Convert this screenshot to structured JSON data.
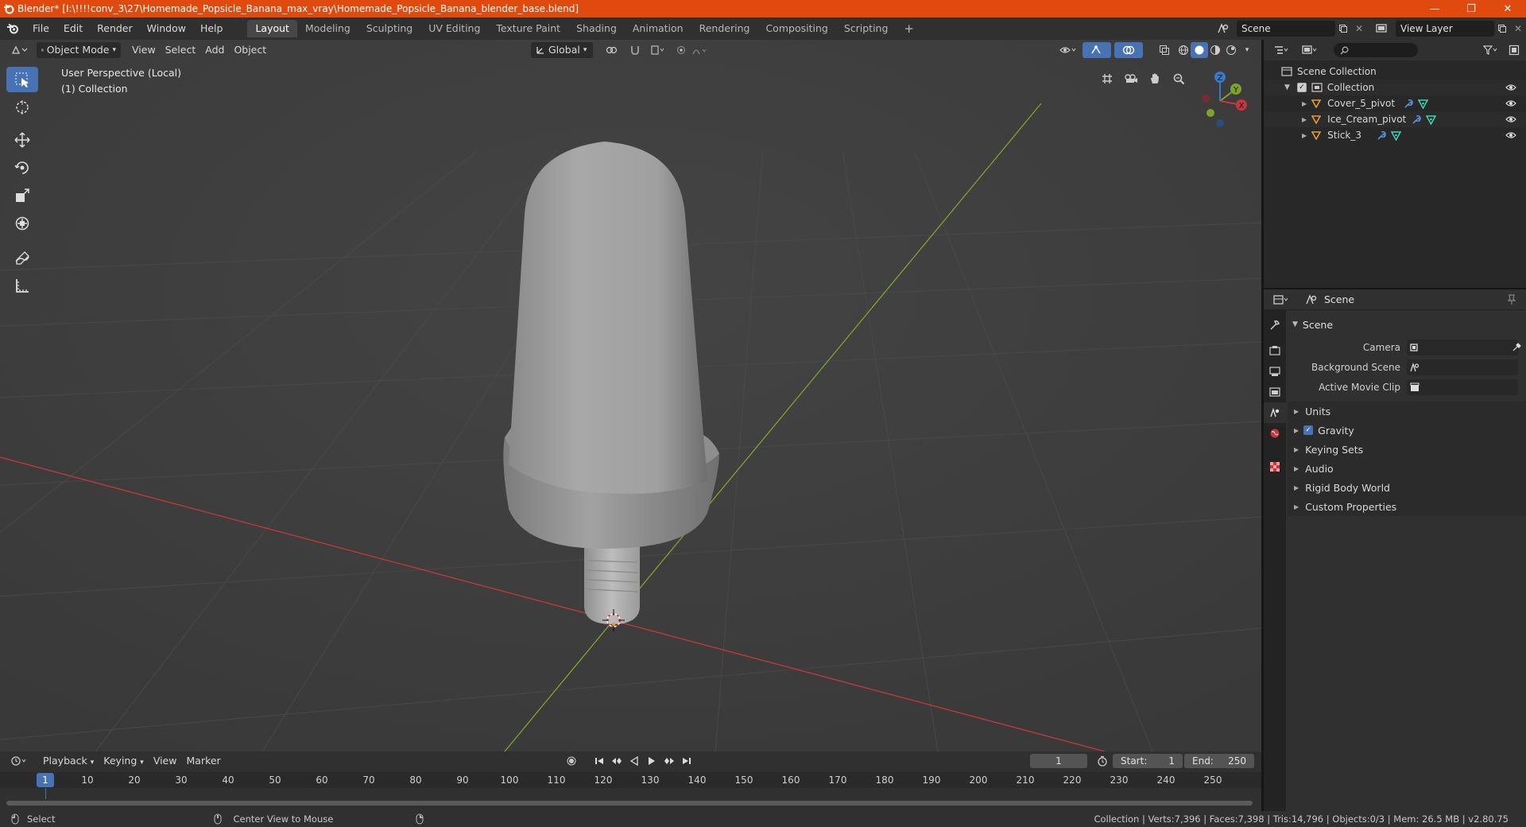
{
  "window": {
    "title": "Blender* [I:\\!!!!conv_3\\27\\Homemade_Popsicle_Banana_max_vray\\Homemade_Popsicle_Banana_blender_base.blend]",
    "minimize": "—",
    "maximize": "❐",
    "close": "✕"
  },
  "menu": {
    "items": [
      "File",
      "Edit",
      "Render",
      "Window",
      "Help"
    ],
    "workspaces": [
      "Layout",
      "Modeling",
      "Sculpting",
      "UV Editing",
      "Texture Paint",
      "Shading",
      "Animation",
      "Rendering",
      "Compositing",
      "Scripting"
    ],
    "active_workspace": "Layout",
    "add_tab": "+",
    "scene": "Scene",
    "view_layer": "View Layer"
  },
  "viewport": {
    "mode": "Object Mode",
    "menus": [
      "View",
      "Select",
      "Add",
      "Object"
    ],
    "orientation": "Global",
    "info_line1": "User Perspective (Local)",
    "info_line2": "(1) Collection",
    "gizmo": {
      "x": "X",
      "y": "Y",
      "z": "Z"
    }
  },
  "outliner": {
    "search_placeholder": "",
    "root": "Scene Collection",
    "collection": "Collection",
    "objects": [
      "Cover_5_pivot",
      "Ice_Cream_pivot",
      "Stick_3"
    ]
  },
  "properties": {
    "context": "Scene",
    "panel_title": "Scene",
    "rows": {
      "camera": "Camera",
      "background_scene": "Background Scene",
      "active_movie_clip": "Active Movie Clip"
    },
    "subpanels": [
      "Units",
      "Gravity",
      "Keying Sets",
      "Audio",
      "Rigid Body World",
      "Custom Properties"
    ]
  },
  "timeline": {
    "menus": [
      "Playback",
      "Keying",
      "View",
      "Marker"
    ],
    "current_frame": "1",
    "start_label": "Start:",
    "start": "1",
    "end_label": "End:",
    "end": "250",
    "ticks": [
      "1",
      "10",
      "20",
      "30",
      "40",
      "50",
      "60",
      "70",
      "80",
      "90",
      "100",
      "110",
      "120",
      "130",
      "140",
      "150",
      "160",
      "170",
      "180",
      "190",
      "200",
      "210",
      "220",
      "230",
      "240",
      "250"
    ]
  },
  "status": {
    "left_action": "Select",
    "middle_action": "Center View to Mouse",
    "stats": "Collection | Verts:7,396 | Faces:7,398 | Tris:14,796 | Objects:0/3 | Mem: 26.5 MB | v2.80.75"
  },
  "colors": {
    "titlebar": "#e04a0f",
    "accent": "#4772b3",
    "x_axis": "#c8373f",
    "y_axis": "#7fa32a",
    "z_axis": "#3a78c8",
    "object_icon": "#e79a3c",
    "modifier_icon": "#5b8fd8",
    "mesh_icon": "#3dd6b5"
  }
}
